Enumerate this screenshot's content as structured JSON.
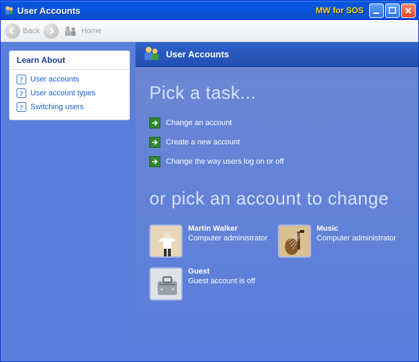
{
  "titlebar": {
    "title": "User Accounts",
    "tag": "MW for SOS"
  },
  "toolbar": {
    "back_label": "Back",
    "home_label": "Home"
  },
  "sidebar": {
    "panel_title": "Learn About",
    "items": [
      {
        "label": "User accounts"
      },
      {
        "label": "User account types"
      },
      {
        "label": "Switching users"
      }
    ]
  },
  "main": {
    "header_title": "User Accounts",
    "heading_tasks": "Pick a task...",
    "tasks": [
      {
        "label": "Change an account"
      },
      {
        "label": "Create a new account"
      },
      {
        "label": "Change the way users log on or off"
      }
    ],
    "heading_accounts": "or pick an account to change",
    "accounts": [
      {
        "name": "Martin Walker",
        "role": "Computer administrator",
        "avatar_bg": "#e7d7b8"
      },
      {
        "name": "Music",
        "role": "Computer administrator",
        "avatar_bg": "#c7a870"
      },
      {
        "name": "Guest",
        "role": "Guest account is off",
        "avatar_bg": "#cfd4d8"
      }
    ]
  }
}
